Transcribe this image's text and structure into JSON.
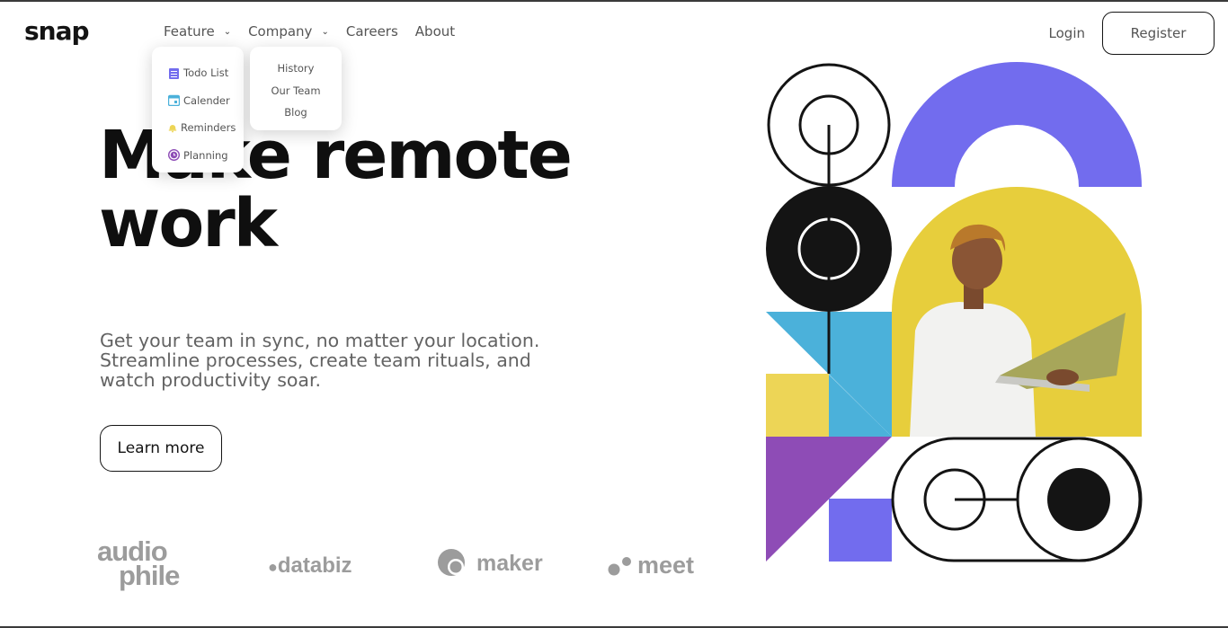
{
  "brand": {
    "logo": "snap"
  },
  "nav": {
    "items": [
      {
        "label": "Feature",
        "has_menu": true
      },
      {
        "label": "Company",
        "has_menu": true
      },
      {
        "label": "Careers",
        "has_menu": false
      },
      {
        "label": "About",
        "has_menu": false
      }
    ],
    "feature_menu": [
      {
        "label": "Todo List",
        "icon": "todo-icon",
        "color": "#726CEE"
      },
      {
        "label": "Calender",
        "icon": "calendar-icon",
        "color": "#4BB1DA"
      },
      {
        "label": "Reminders",
        "icon": "bell-icon",
        "color": "#EDD556"
      },
      {
        "label": "Planning",
        "icon": "planning-icon",
        "color": "#8E4CB6"
      }
    ],
    "company_menu": [
      {
        "label": "History"
      },
      {
        "label": "Our Team"
      },
      {
        "label": "Blog"
      }
    ]
  },
  "auth": {
    "login": "Login",
    "register": "Register"
  },
  "hero": {
    "title_line1": "Make remote",
    "title_line2": "work",
    "text": "Get your team in sync, no matter your location. Streamline processes, create team rituals, and watch productivity soar.",
    "cta": "Learn more"
  },
  "clients": [
    {
      "line1": "audio",
      "line2": "phile"
    },
    {
      "name": "databiz"
    },
    {
      "name": "maker"
    },
    {
      "name": "meet"
    }
  ],
  "colors": {
    "purple": "#726CEE",
    "blue": "#4BB1DA",
    "yellow": "#EDD556",
    "violet": "#8E4CB6",
    "dark": "#141414"
  }
}
